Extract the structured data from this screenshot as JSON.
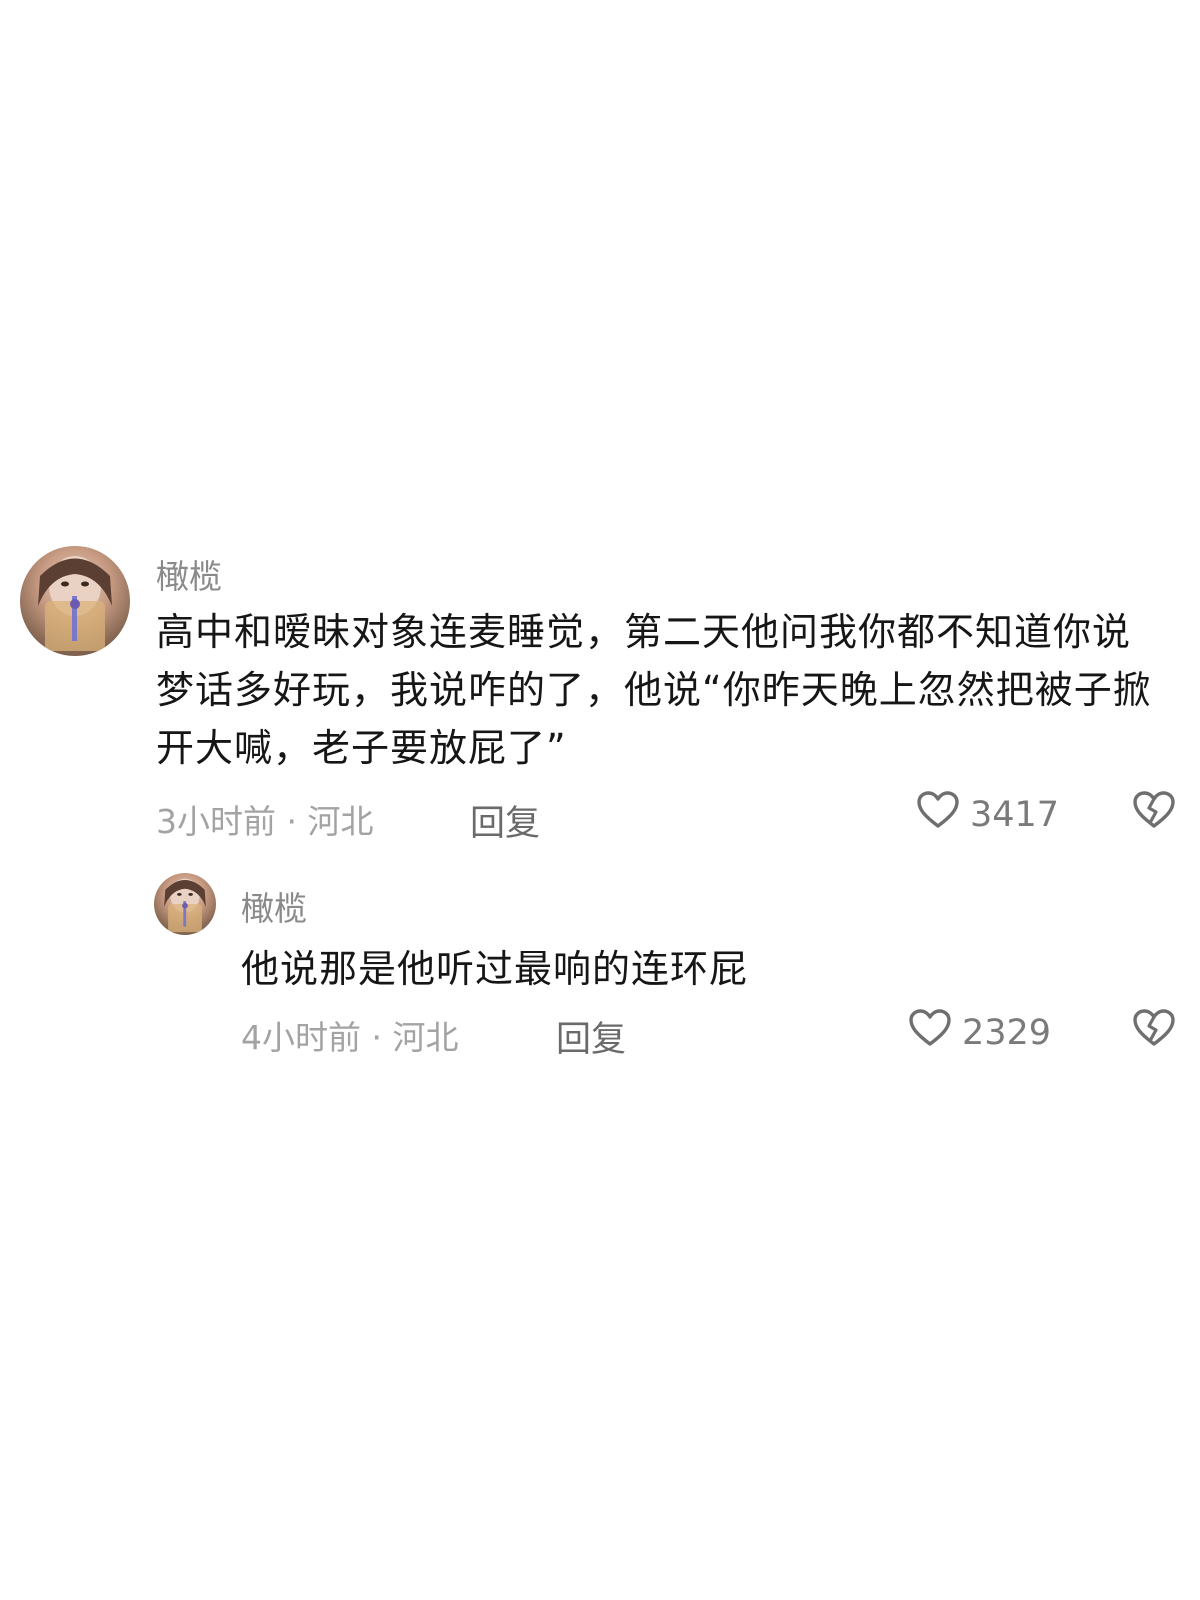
{
  "comments": [
    {
      "username": "橄榄",
      "text": "高中和暧昧对象连麦睡觉，第二天他问我你都不知道你说梦话多好玩，我说咋的了，他说“你昨天晚上忽然把被子掀开大喊，老子要放屁了”",
      "meta": "3小时前 · 河北",
      "reply_label": "回复",
      "like_count": "3417",
      "like_icon": "heart-outline-icon",
      "dislike_icon": "broken-heart-icon"
    },
    {
      "username": "橄榄",
      "text": "他说那是他听过最响的连环屁",
      "meta": "4小时前 · 河北",
      "reply_label": "回复",
      "like_count": "2329",
      "like_icon": "heart-outline-icon",
      "dislike_icon": "broken-heart-icon"
    }
  ],
  "colors": {
    "text": "#161616",
    "username": "#8a8a8a",
    "meta": "#a3a3a3",
    "icon": "#6f6f6f",
    "background": "#ffffff"
  }
}
